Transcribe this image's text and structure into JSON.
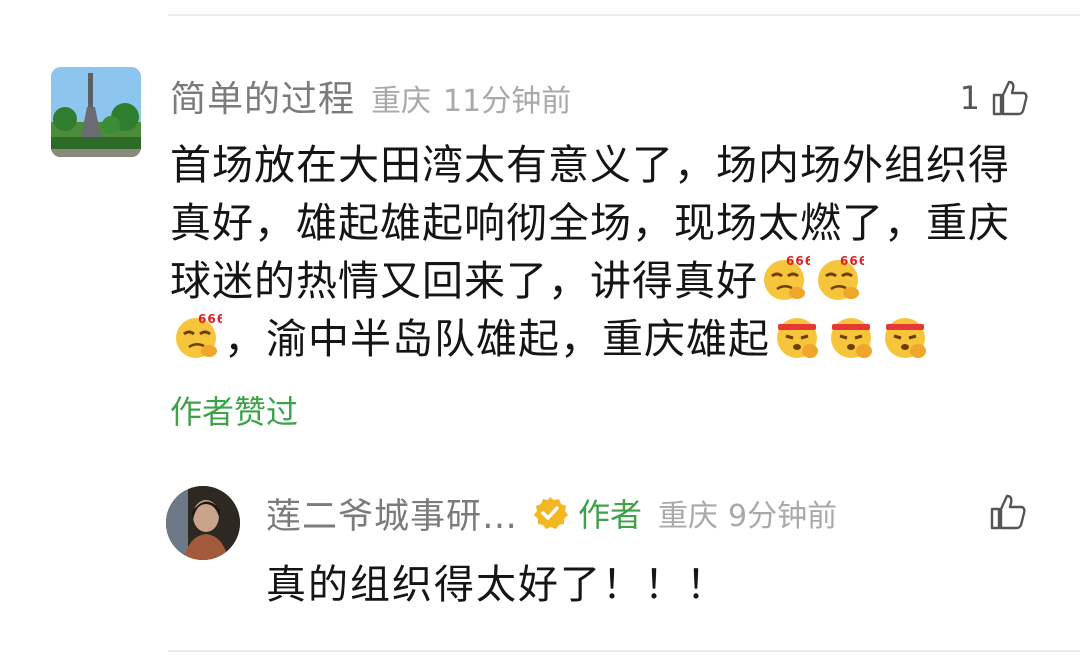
{
  "comment": {
    "nickname": "简单的过程",
    "location": "重庆",
    "time": "11分钟前",
    "like_count": "1",
    "text_part1": "首场放在大田湾太有意义了，场内场外组织得真好，雄起雄起响彻全场，现场太燃了，重庆球迷的热情又回来了，讲得真好",
    "text_part2": "，渝中半岛队雄起，重庆雄起",
    "emoji_a": "666-smirk-emoji",
    "emoji_b": "fist-headband-emoji",
    "author_liked": "作者赞过"
  },
  "reply": {
    "nickname": "莲二爷城事研…",
    "author_tag": "作者",
    "location": "重庆",
    "time": "9分钟前",
    "text": "真的组织得太好了！！！"
  },
  "colors": {
    "accent_green": "#3fa24b",
    "verified_gold": "#f2b821",
    "meta_gray": "#a9a9a9"
  }
}
